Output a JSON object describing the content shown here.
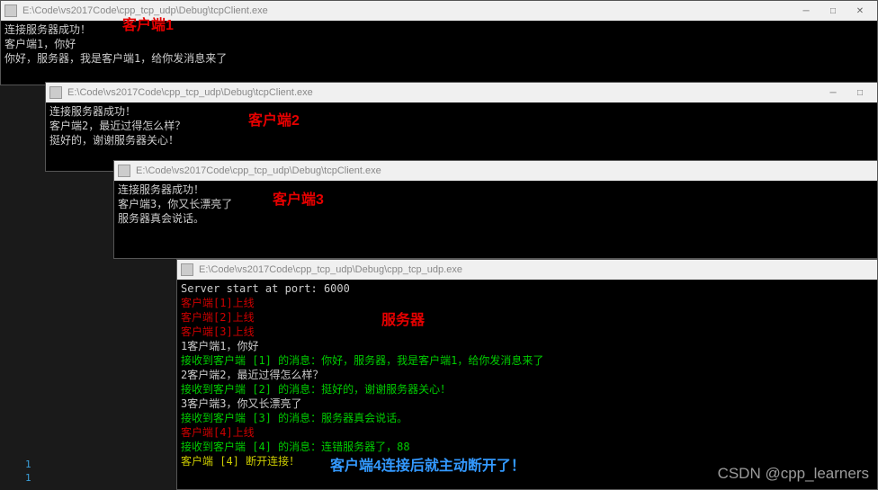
{
  "win1": {
    "title": "E:\\Code\\vs2017Code\\cpp_tcp_udp\\Debug\\tcpClient.exe",
    "lines": [
      "连接服务器成功！",
      "客户端1，你好",
      "你好，服务器，我是客户端1，给你发消息来了"
    ],
    "annotation": "客户端1"
  },
  "win2": {
    "title": "E:\\Code\\vs2017Code\\cpp_tcp_udp\\Debug\\tcpClient.exe",
    "lines": [
      "连接服务器成功！",
      "客户端2，最近过得怎么样？",
      "挺好的，谢谢服务器关心！"
    ],
    "annotation": "客户端2"
  },
  "win3": {
    "title": "E:\\Code\\vs2017Code\\cpp_tcp_udp\\Debug\\tcpClient.exe",
    "lines": [
      "连接服务器成功！",
      "客户端3，你又长漂亮了",
      "服务器真会说话。"
    ],
    "annotation": "客户端3"
  },
  "win4": {
    "title": "E:\\Code\\vs2017Code\\cpp_tcp_udp\\Debug\\cpp_tcp_udp.exe",
    "lines": [
      {
        "text": "Server start at port: 6000",
        "cls": "white-text"
      },
      {
        "text": "客户端[1]上线",
        "cls": "red-text"
      },
      {
        "text": "客户端[2]上线",
        "cls": "red-text"
      },
      {
        "text": "客户端[3]上线",
        "cls": "red-text"
      },
      {
        "text": "1客户端1，你好",
        "cls": "white-text"
      },
      {
        "text": "接收到客户端 [1] 的消息：你好，服务器，我是客户端1，给你发消息来了",
        "cls": "green-text"
      },
      {
        "text": "2客户端2，最近过得怎么样？",
        "cls": "white-text"
      },
      {
        "text": "接收到客户端 [2] 的消息：挺好的，谢谢服务器关心！",
        "cls": "green-text"
      },
      {
        "text": "3客户端3，你又长漂亮了",
        "cls": "white-text"
      },
      {
        "text": "接收到客户端 [3] 的消息：服务器真会说话。",
        "cls": "green-text"
      },
      {
        "text": "客户端[4]上线",
        "cls": "red-text"
      },
      {
        "text": "接收到客户端 [4] 的消息：连错服务器了，88",
        "cls": "green-text"
      },
      {
        "text": "客户端 [4] 断开连接！",
        "cls": "yellow-text"
      }
    ],
    "annotation_server": "服务器",
    "annotation_client4": "客户端4连接后就主动断开了！"
  },
  "controls": {
    "min": "─",
    "max": "□",
    "close": "✕"
  },
  "watermark": "CSDN @cpp_learners",
  "linenums": {
    "a": "1",
    "b": "1"
  }
}
